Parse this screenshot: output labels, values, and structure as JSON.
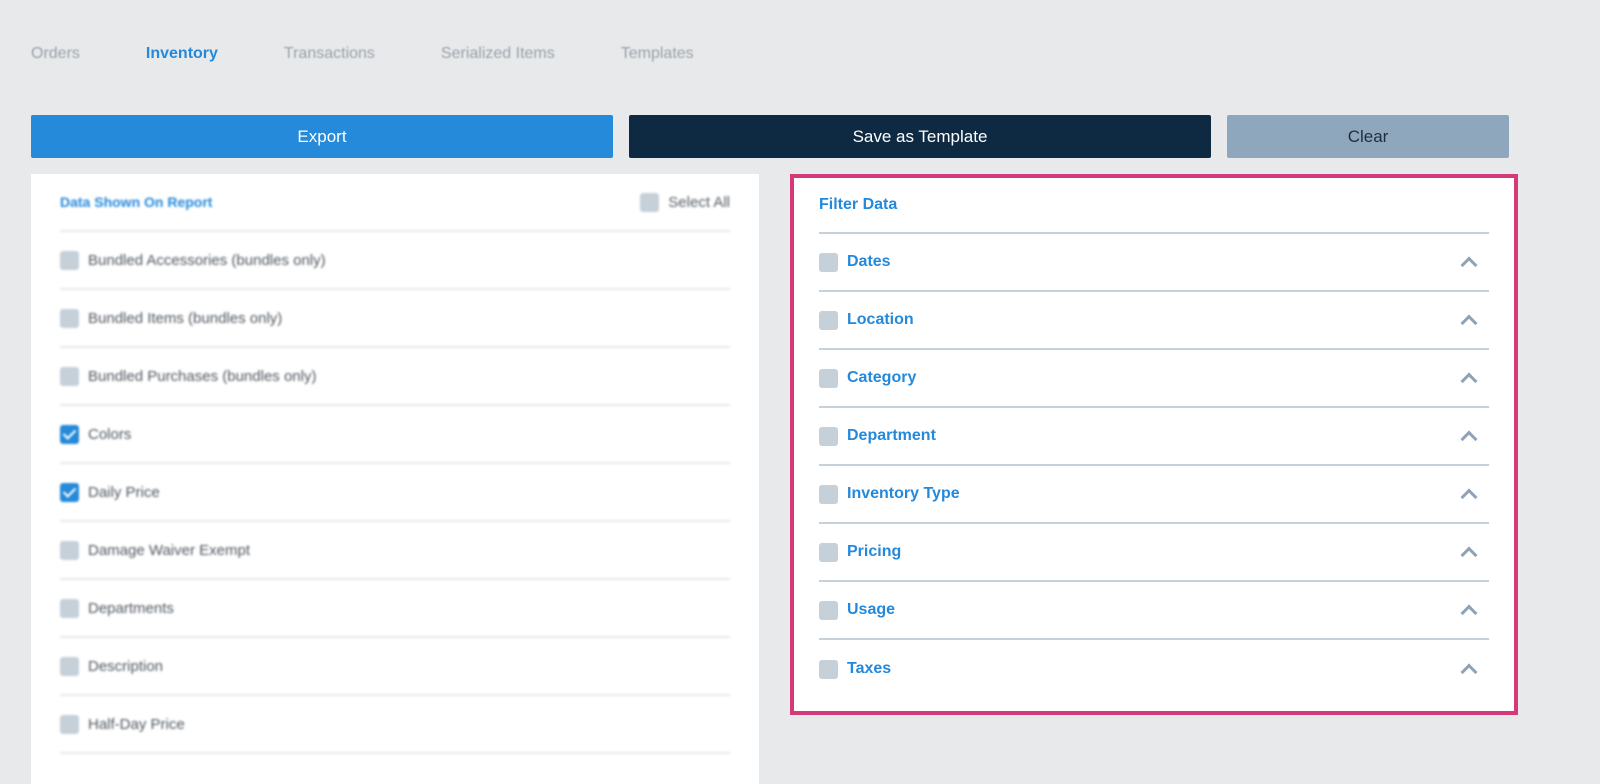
{
  "tabs": [
    {
      "label": "Orders"
    },
    {
      "label": "Inventory",
      "active": true
    },
    {
      "label": "Transactions"
    },
    {
      "label": "Serialized Items"
    },
    {
      "label": "Templates"
    }
  ],
  "buttons": {
    "export": "Export",
    "save": "Save as Template",
    "clear": "Clear"
  },
  "left_panel": {
    "title": "Data Shown On Report",
    "select_all": "Select All",
    "items": [
      {
        "label": "Bundled Accessories (bundles only)",
        "checked": false
      },
      {
        "label": "Bundled Items (bundles only)",
        "checked": false
      },
      {
        "label": "Bundled Purchases (bundles only)",
        "checked": false
      },
      {
        "label": "Colors",
        "checked": true
      },
      {
        "label": "Daily Price",
        "checked": true
      },
      {
        "label": "Damage Waiver Exempt",
        "checked": false
      },
      {
        "label": "Departments",
        "checked": false
      },
      {
        "label": "Description",
        "checked": false
      },
      {
        "label": "Half-Day Price",
        "checked": false
      }
    ]
  },
  "right_panel": {
    "title": "Filter Data",
    "highlight_color": "#d6397a",
    "items": [
      {
        "label": "Dates"
      },
      {
        "label": "Location"
      },
      {
        "label": "Category"
      },
      {
        "label": "Department"
      },
      {
        "label": "Inventory Type"
      },
      {
        "label": "Pricing"
      },
      {
        "label": "Usage"
      },
      {
        "label": "Taxes"
      }
    ]
  }
}
